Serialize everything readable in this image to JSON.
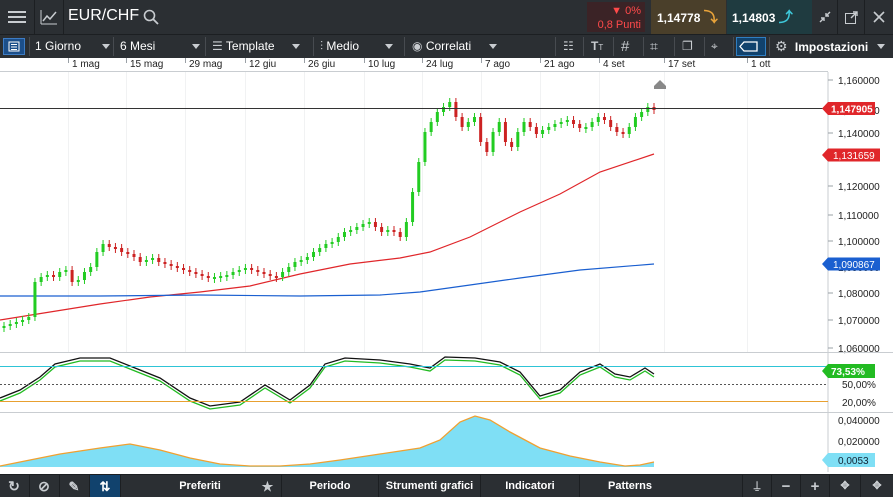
{
  "header": {
    "symbol": "EUR/CHF",
    "change_percent": "0%",
    "change_points": "0,8 Punti",
    "bid": "1,14778",
    "ask": "1,14803"
  },
  "toolbar": {
    "interval": "1 Giorno",
    "period": "6 Mesi",
    "template": "Template",
    "chart_type": "Medio",
    "correlated": "Correlati",
    "settings": "Impostazioni"
  },
  "date_axis": [
    "1 mag",
    "15 mag",
    "29 mag",
    "12 giu",
    "26 giu",
    "10 lug",
    "24 lug",
    "7 ago",
    "21 ago",
    "4 set",
    "17 set",
    "1 ott"
  ],
  "price_axis": [
    "1,160000",
    "1,150000",
    "1,140000",
    "1,130000",
    "1,120000",
    "1,110000",
    "1,100000",
    "1,090000",
    "1,080000",
    "1,070000",
    "1,060000"
  ],
  "price_labels": {
    "last": "1,147905",
    "ma_red": "1,131659",
    "ma_blue": "1,090867"
  },
  "stochastic": {
    "value_label": "73,53%",
    "levels": [
      "50,00%",
      "20,00%"
    ]
  },
  "volume_panel": {
    "axis": [
      "0,040000",
      "0,020000"
    ],
    "value_label": "0,0053"
  },
  "bottom_bar": {
    "favorites": "Preferiti",
    "period": "Periodo",
    "tools": "Strumenti grafici",
    "indicators": "Indicatori",
    "patterns": "Patterns"
  },
  "colors": {
    "background_dark": "#2b2f33",
    "up_candle": "#22cc22",
    "down_candle": "#cc2222",
    "ma_red": "#e0262a",
    "ma_blue": "#1a5fd0",
    "osc_fill": "#7fdff5",
    "osc_line": "#f0a030",
    "accent_teal": "#2ec4d6"
  },
  "icons": {
    "menu": "hamburger-icon",
    "chart": "line-chart-icon",
    "search": "search-icon",
    "arrow_down": "down-triangle-icon",
    "bid_arrow": "down-arrow-icon",
    "ask_arrow": "up-arrow-icon",
    "collapse": "collapse-icon",
    "popout": "popout-icon",
    "close": "close-icon"
  }
}
